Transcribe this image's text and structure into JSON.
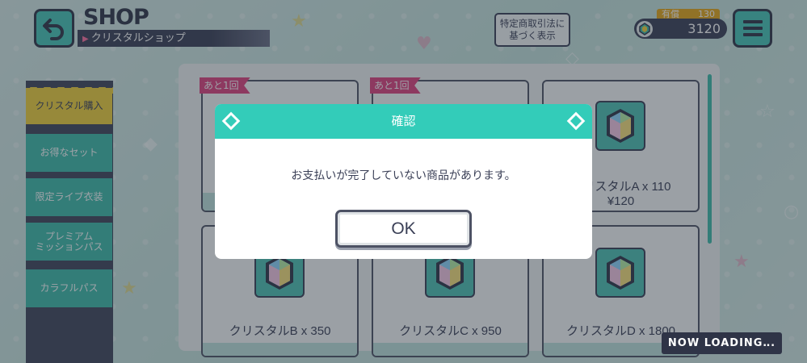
{
  "header": {
    "title": "SHOP",
    "subtitle": "クリスタルショップ",
    "legal_line1": "特定商取引法に",
    "legal_line2": "基づく表示"
  },
  "currency": {
    "paid_label": "有償",
    "paid_value": "130",
    "total": "3120"
  },
  "sidebar": {
    "items": [
      {
        "label": "クリスタル購入",
        "active": true
      },
      {
        "label": "お得なセット",
        "active": false
      },
      {
        "label": "限定ライブ衣装",
        "active": false
      },
      {
        "label_line1": "プレミアム",
        "label_line2": "ミッションパス",
        "active": false
      },
      {
        "label": "カラフルパス",
        "active": false
      }
    ]
  },
  "products": [
    {
      "badge": "あと1回"
    },
    {
      "badge": "あと1回"
    },
    {
      "name": "クリスタルA x 110",
      "price": "¥120"
    },
    {
      "name": "クリスタルB x 350"
    },
    {
      "name": "クリスタルC x 950"
    },
    {
      "name": "クリスタルD x 1800"
    }
  ],
  "dialog": {
    "title": "確認",
    "message": "お支払いが完了していない商品があります。",
    "ok_label": "OK"
  },
  "loading": "NOW LOADING‥.",
  "colors": {
    "accent": "#33ccb9",
    "sidebar_active": "#f2d23a",
    "badge": "#e0407e",
    "dark": "#3a3f56"
  },
  "icons": {
    "back": "back-arrow-icon",
    "menu": "hamburger-menu-icon",
    "currency": "crystal-icon",
    "product": "crystal-gem-icon"
  }
}
